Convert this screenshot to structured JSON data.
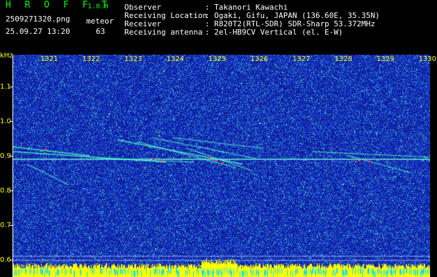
{
  "header": {
    "app_title": "H R O F F T",
    "version": "1.0.0",
    "filename": "2509271320.png",
    "datetime": "25.09.27 13:20",
    "category_label": "meteor",
    "count": "63",
    "info": [
      {
        "label": "Observer",
        "value": ": Takanori Kawachi"
      },
      {
        "label": "Receiving Location",
        "value": ": Ogaki, Gifu, JAPAN (136.60E, 35.35N)"
      },
      {
        "label": "Receiver",
        "value": ": R820T2(RTL-SDR) SDR-Sharp 53.372MHz"
      },
      {
        "label": "Receiving antenna",
        "value": ": 2el-HB9CV Vertical (el. E-W)"
      }
    ]
  },
  "axes": {
    "y_unit": "kHz",
    "y_ticks": [
      "1.1",
      "1.0",
      "0.9",
      "0.8",
      "0.7",
      "0.6"
    ],
    "time_labels": [
      "1321",
      "1322",
      "1323",
      "1324",
      "1325",
      "1326",
      "1327",
      "1328",
      "1329",
      "1330"
    ]
  },
  "colors": {
    "background": "#000000",
    "spectrum_base": "#1a2ac8",
    "header_green": "#00ff00",
    "label_yellow": "#ffff00",
    "trace_cyan": "#40ffd0",
    "trace_red": "#ff3040"
  }
}
